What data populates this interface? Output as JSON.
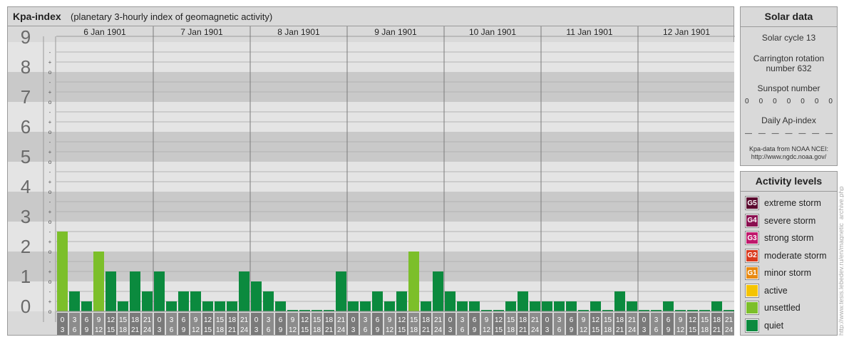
{
  "header": {
    "title": "Kpa-index",
    "subtitle": "(planetary 3-hourly index of geomagnetic activity)"
  },
  "chart_data": {
    "type": "bar",
    "ylim": [
      0,
      9
    ],
    "y_ticks": [
      "0",
      "1",
      "2",
      "3",
      "4",
      "5",
      "6",
      "7",
      "8",
      "9"
    ],
    "sub_ticks": [
      "o",
      "-",
      "+",
      "o"
    ],
    "days": [
      "6 Jan 1901",
      "7 Jan 1901",
      "8 Jan 1901",
      "9 Jan 1901",
      "10 Jan 1901",
      "11 Jan 1901",
      "12 Jan 1901"
    ],
    "interval_labels": [
      [
        "0",
        "3"
      ],
      [
        "3",
        "6"
      ],
      [
        "6",
        "9"
      ],
      [
        "9",
        "12"
      ],
      [
        "12",
        "15"
      ],
      [
        "15",
        "18"
      ],
      [
        "18",
        "21"
      ],
      [
        "21",
        "24"
      ]
    ],
    "values": [
      [
        2.667,
        0.667,
        0.333,
        2.0,
        1.333,
        0.333,
        1.333,
        0.667
      ],
      [
        1.333,
        0.333,
        0.667,
        0.667,
        0.333,
        0.333,
        0.333,
        1.333
      ],
      [
        1.0,
        0.667,
        0.333,
        0.0,
        0.0,
        0.0,
        0.0,
        1.333
      ],
      [
        0.333,
        0.333,
        0.667,
        0.333,
        0.667,
        2.0,
        0.333,
        1.333
      ],
      [
        0.667,
        0.333,
        0.333,
        0.0,
        0.0,
        0.333,
        0.667,
        0.333
      ],
      [
        0.333,
        0.333,
        0.333,
        0.0,
        0.333,
        0.0,
        0.667,
        0.333
      ],
      [
        0.0,
        0.0,
        0.333,
        0.0,
        0.0,
        0.0,
        0.333,
        0.0
      ]
    ],
    "colors": {
      "quiet": "#0b8a3e",
      "unsettled": "#7cbf2a",
      "band_light": "#e4e4e4",
      "band_dark": "#c9c9c9",
      "axis_box": "#7a7a7a",
      "axis_box_alt": "#8c8c8c"
    }
  },
  "solar": {
    "title": "Solar data",
    "cycle": "Solar cycle 13",
    "carrington_line1": "Carrington rotation",
    "carrington_line2": "number 632",
    "sunspot_label": "Sunspot number",
    "sunspot_values": [
      "0",
      "0",
      "0",
      "0",
      "0",
      "0",
      "0"
    ],
    "ap_label": "Daily Ap-index",
    "ap_values": [
      "—",
      "—",
      "—",
      "—",
      "—",
      "—",
      "—"
    ],
    "source_line1": "Kpa-data from NOAA NCEI:",
    "source_line2": "http://www.ngdc.noaa.gov/"
  },
  "activity": {
    "title": "Activity levels",
    "levels": [
      {
        "badge": "G5",
        "label": "extreme storm",
        "color": "#5a0a2e"
      },
      {
        "badge": "G4",
        "label": "severe storm",
        "color": "#8a1050"
      },
      {
        "badge": "G3",
        "label": "strong storm",
        "color": "#c0186c"
      },
      {
        "badge": "G2",
        "label": "moderate storm",
        "color": "#d93a1e"
      },
      {
        "badge": "G1",
        "label": "minor storm",
        "color": "#e88a12"
      },
      {
        "badge": "",
        "label": "active",
        "color": "#f5c400"
      },
      {
        "badge": "",
        "label": "unsettled",
        "color": "#7cbf2a"
      },
      {
        "badge": "",
        "label": "quiet",
        "color": "#0b8a3e"
      }
    ]
  },
  "watermark": "http://www.tesis.lebedev.ru/en/magnetic_archive.php"
}
